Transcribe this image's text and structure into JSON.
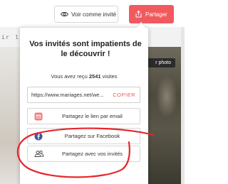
{
  "header": {
    "guest_view_label": "Voir comme invité",
    "share_label": "Partager"
  },
  "background": {
    "partial_text": "ir l",
    "photo_button_label": "r photo"
  },
  "popover": {
    "title": "Vos invités sont impatients de le découvrir !",
    "visits_prefix": "Vous avez reçu ",
    "visits_count": "2541",
    "visits_suffix": " visites",
    "link_url": "https://www.mariages.net/we...",
    "copy_label": "COPIER",
    "options": [
      {
        "label": "Partagez le lien par email",
        "icon": "email-icon"
      },
      {
        "label": "Partagez sur Facebook",
        "icon": "facebook-icon"
      },
      {
        "label": "Partagez avec vos invités",
        "icon": "guests-icon"
      }
    ]
  },
  "colors": {
    "accent": "#f05a5f",
    "facebook": "#3b5998",
    "annotation": "#e8262b"
  }
}
